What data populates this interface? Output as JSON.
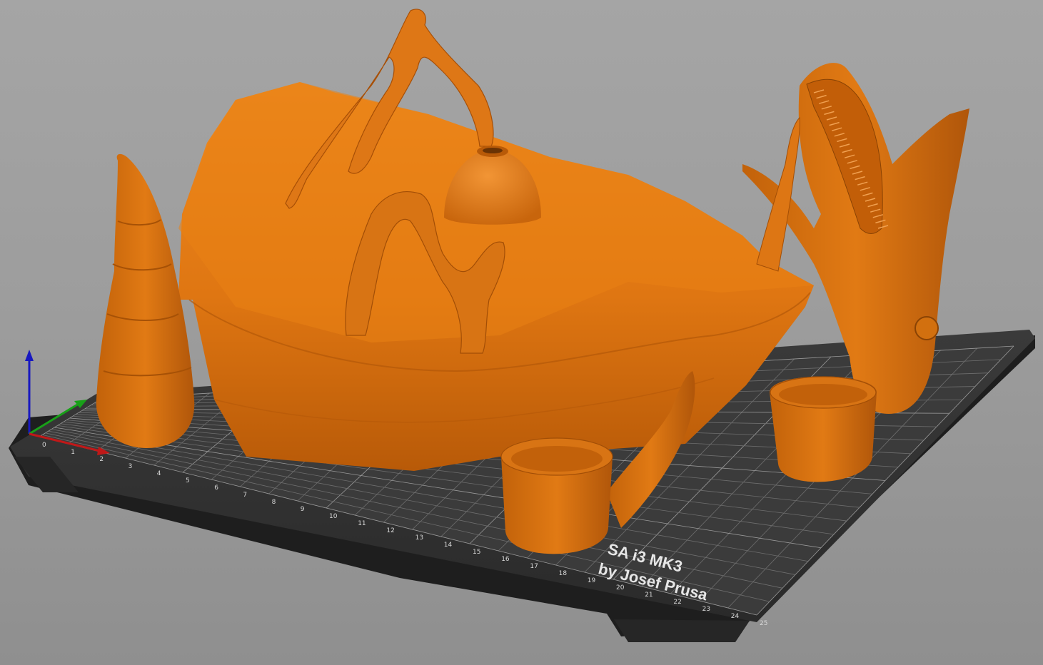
{
  "app": {
    "view": "3D plater view",
    "object_color": "#e07a10",
    "bed_color": "#2f2f2f",
    "grid_color": "#8a8a8a",
    "background_color": "#9f9f9f"
  },
  "bed": {
    "logo_line1": "SA i3 MK3",
    "logo_line2": "by Josef Prusa",
    "logo_partial": "PRU",
    "x_ticks": [
      "0",
      "1",
      "2",
      "3",
      "4",
      "5",
      "6",
      "7",
      "8",
      "9",
      "10",
      "11",
      "12",
      "13",
      "14",
      "15",
      "16",
      "17",
      "18",
      "19",
      "20",
      "21",
      "22",
      "23",
      "24",
      "25"
    ]
  },
  "axes": {
    "x_color": "#c01818",
    "y_color": "#18a018",
    "z_color": "#1818c0"
  },
  "objects": [
    {
      "name": "terrain-base",
      "icon": "landscape-model"
    },
    {
      "name": "horn-spire",
      "icon": "cone-model"
    },
    {
      "name": "sandworm-head",
      "icon": "creature-model"
    },
    {
      "name": "cup-with-horn",
      "icon": "cup-model"
    },
    {
      "name": "small-cup",
      "icon": "cup-model"
    },
    {
      "name": "dome",
      "icon": "dome-model"
    },
    {
      "name": "branch-arch-front",
      "icon": "branch-model"
    },
    {
      "name": "branch-arch-back",
      "icon": "branch-model"
    }
  ]
}
